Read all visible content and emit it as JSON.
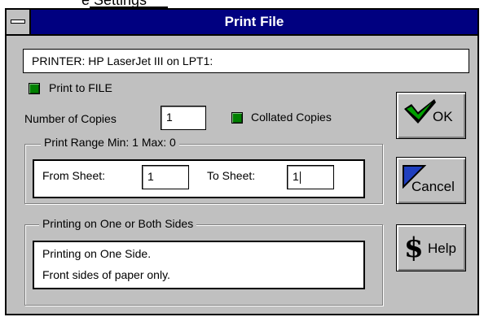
{
  "background": {
    "partial_text": "e Settings"
  },
  "window": {
    "title": "Print File"
  },
  "printer": {
    "value": "PRINTER: HP LaserJet III on LPT1:"
  },
  "print_to_file": {
    "label": "Print to FILE",
    "checked": true
  },
  "copies": {
    "label": "Number of Copies",
    "value": "1"
  },
  "collated": {
    "label": "Collated Copies",
    "checked": true
  },
  "print_range": {
    "legend": "Print Range Min: 1  Max: 0",
    "from_label": "From Sheet:",
    "from_value": "1",
    "to_label": "To Sheet:",
    "to_value": "1"
  },
  "sides": {
    "legend": "Printing on One or Both Sides",
    "line1": "Printing on One Side.",
    "line2": "Front sides of paper only."
  },
  "buttons": {
    "ok": "OK",
    "cancel": "Cancel",
    "help": "Help"
  },
  "colors": {
    "title_bar": "#000080",
    "dialog_face": "#c0c0c0",
    "checkbox_checked": "#008000",
    "cancel_icon": "#1f3fbf"
  },
  "icons": {
    "sysmenu": "sysmenu-icon",
    "ok": "green-checkmark-icon",
    "cancel": "blue-corner-icon",
    "help": "dollar-help-icon"
  }
}
